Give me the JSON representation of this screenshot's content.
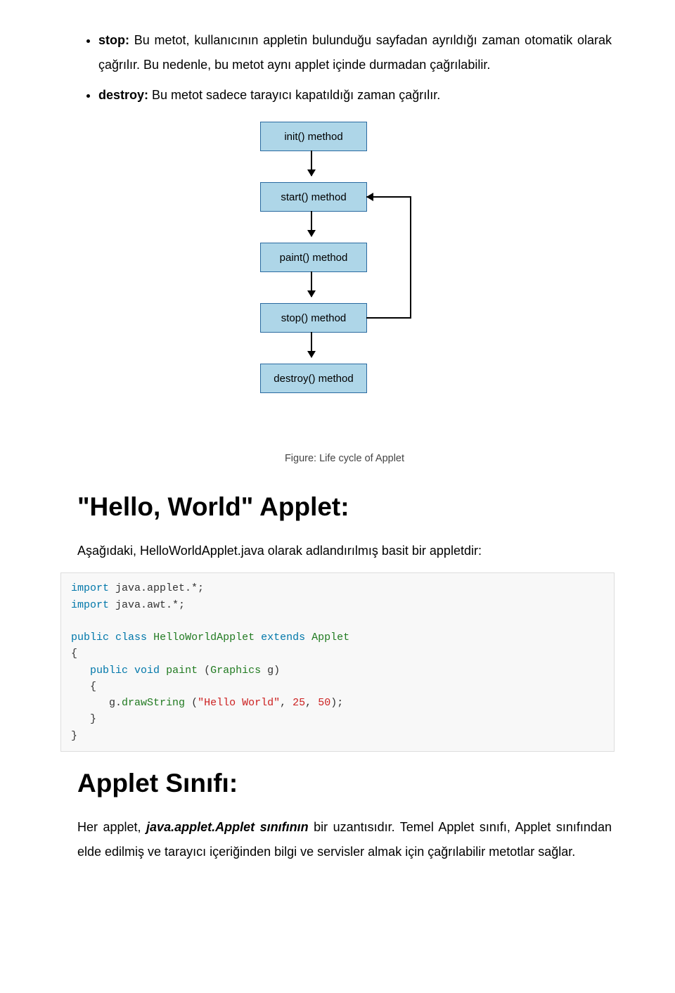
{
  "bullets": {
    "stop_label": "stop:",
    "stop_text": " Bu metot, kullanıcının appletin bulunduğu sayfadan ayrıldığı zaman otomatik olarak çağrılır. Bu nedenle, bu metot aynı applet içinde durmadan çağrılabilir.",
    "destroy_label": "destroy:",
    "destroy_text": " Bu metot sadece tarayıcı kapatıldığı zaman çağrılır."
  },
  "diagram": {
    "n1": "init() method",
    "n2": "start() method",
    "n3": "paint() method",
    "n4": "stop() method",
    "n5": "destroy() method",
    "caption": "Figure: Life cycle of Applet"
  },
  "hw_heading": "\"Hello, World\" Applet:",
  "hw_intro": "Aşağıdaki, HelloWorldApplet.java olarak adlandırılmış basit bir appletdir:",
  "code": {
    "kw_import1": "import",
    "pkg1": " java.applet.*;",
    "kw_import2": "import",
    "pkg2": " java.awt.*;",
    "kw_public1": "public",
    "kw_class": "class",
    "cls_name": "HelloWorldApplet",
    "kw_extends": "extends",
    "cls_parent": "Applet",
    "brace_open1": "{",
    "kw_public2": "public",
    "kw_void": "void",
    "fn_paint": " paint ",
    "paren_open": "(",
    "cls_graphics": "Graphics",
    "arg_g": " g",
    "paren_close": ")",
    "brace_open2": "   {",
    "obj_g": "      g",
    "dot": ".",
    "fn_draw": "drawString ",
    "paren_open2": "(",
    "str_hello": "\"Hello World\"",
    "comma1": ",",
    "num1": "25",
    "comma2": ",",
    "num2": "50",
    "paren_close2_semi": ");",
    "brace_close2": "   }",
    "brace_close1": "}"
  },
  "sinifi_heading": "Applet Sınıfı:",
  "sinifi_p_prefix": "Her applet, ",
  "sinifi_p_em": "java.applet.Applet sınıfının",
  "sinifi_p_rest": " bir uzantısıdır. Temel Applet sınıfı, Applet sınıfından elde edilmiş ve tarayıcı içeriğinden bilgi ve servisler almak için çağrılabilir metotlar sağlar."
}
